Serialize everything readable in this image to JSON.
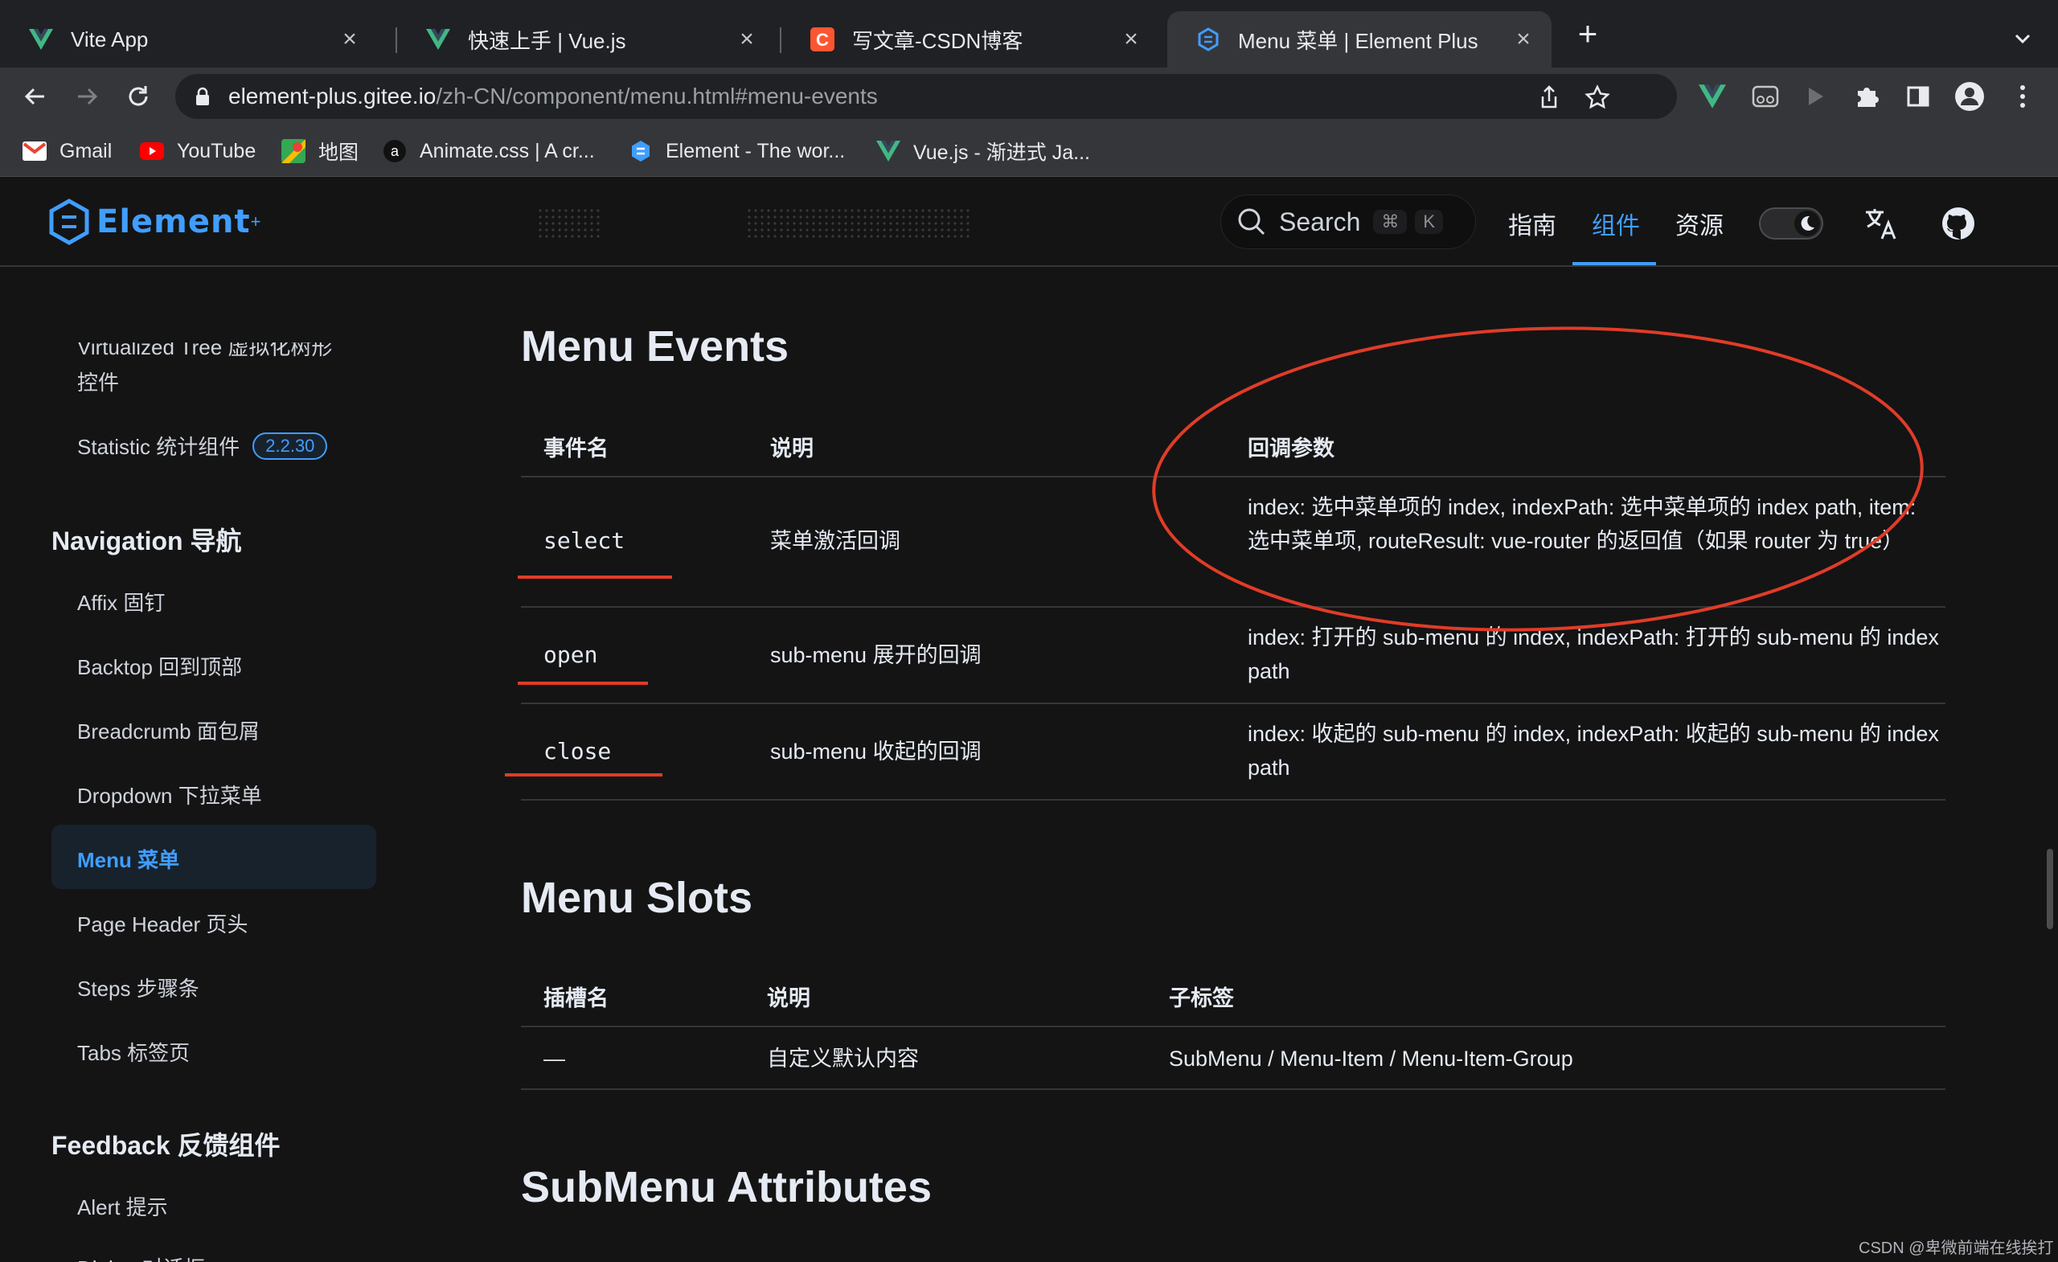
{
  "browser": {
    "tabs": [
      {
        "title": "Vite App",
        "icon": "vue-icon"
      },
      {
        "title": "快速上手 | Vue.js",
        "icon": "vue-icon"
      },
      {
        "title": "写文章-CSDN博客",
        "icon": "csdn-icon"
      },
      {
        "title": "Menu 菜单 | Element Plus",
        "icon": "element-icon",
        "active": true
      }
    ],
    "url_host": "element-plus.gitee.io",
    "url_path": "/zh-CN/component/menu.html#menu-events",
    "bookmarks": [
      {
        "label": "Gmail",
        "icon": "gmail-icon"
      },
      {
        "label": "YouTube",
        "icon": "youtube-icon"
      },
      {
        "label": "地图",
        "icon": "maps-icon"
      },
      {
        "label": "Animate.css | A cr...",
        "icon": "animate-icon"
      },
      {
        "label": "Element - The wor...",
        "icon": "element-icon"
      },
      {
        "label": "Vue.js - 渐进式 Ja...",
        "icon": "vue-icon"
      }
    ]
  },
  "site": {
    "logo_text": "Element",
    "logo_sup": "+",
    "search_placeholder": "Search",
    "search_kbd_1": "⌘",
    "search_kbd_2": "K",
    "nav": [
      {
        "label": "指南",
        "active": false
      },
      {
        "label": "组件",
        "active": true
      },
      {
        "label": "资源",
        "active": false
      }
    ]
  },
  "sidebar": {
    "truncated_item_line1": "Virtualized Tree 虚拟化树形",
    "truncated_item_line2": "控件",
    "statistic_label": "Statistic 统计组件",
    "statistic_badge": "2.2.30",
    "group_navigation": "Navigation 导航",
    "navigation_items": [
      "Affix 固钉",
      "Backtop 回到顶部",
      "Breadcrumb 面包屑",
      "Dropdown 下拉菜单",
      "Menu 菜单",
      "Page Header 页头",
      "Steps 步骤条",
      "Tabs 标签页"
    ],
    "group_feedback": "Feedback 反馈组件",
    "feedback_items": [
      "Alert 提示",
      "Dialog 对话框"
    ]
  },
  "content": {
    "menu_events": {
      "heading": "Menu Events",
      "headers": [
        "事件名",
        "说明",
        "回调参数"
      ],
      "rows": [
        {
          "name": "select",
          "desc": "菜单激活回调",
          "params": "index: 选中菜单项的 index, indexPath: 选中菜单项的 index path, item: 选中菜单项, routeResult: vue-router 的返回值（如果 router 为 true）"
        },
        {
          "name": "open",
          "desc": "sub-menu 展开的回调",
          "params": "index: 打开的 sub-menu 的 index, indexPath: 打开的 sub-menu 的 index path"
        },
        {
          "name": "close",
          "desc": "sub-menu 收起的回调",
          "params": "index: 收起的 sub-menu 的 index, indexPath: 收起的 sub-menu 的 index path"
        }
      ]
    },
    "menu_slots": {
      "heading": "Menu Slots",
      "headers": [
        "插槽名",
        "说明",
        "子标签"
      ],
      "rows": [
        {
          "name": "—",
          "desc": "自定义默认内容",
          "children": "SubMenu / Menu-Item / Menu-Item-Group"
        }
      ]
    },
    "submenu_attributes_heading": "SubMenu Attributes"
  },
  "watermark": "CSDN @卑微前端在线挨打",
  "colors": {
    "accent": "#409eff",
    "annotation_red": "#e03c28",
    "background": "#141414"
  }
}
